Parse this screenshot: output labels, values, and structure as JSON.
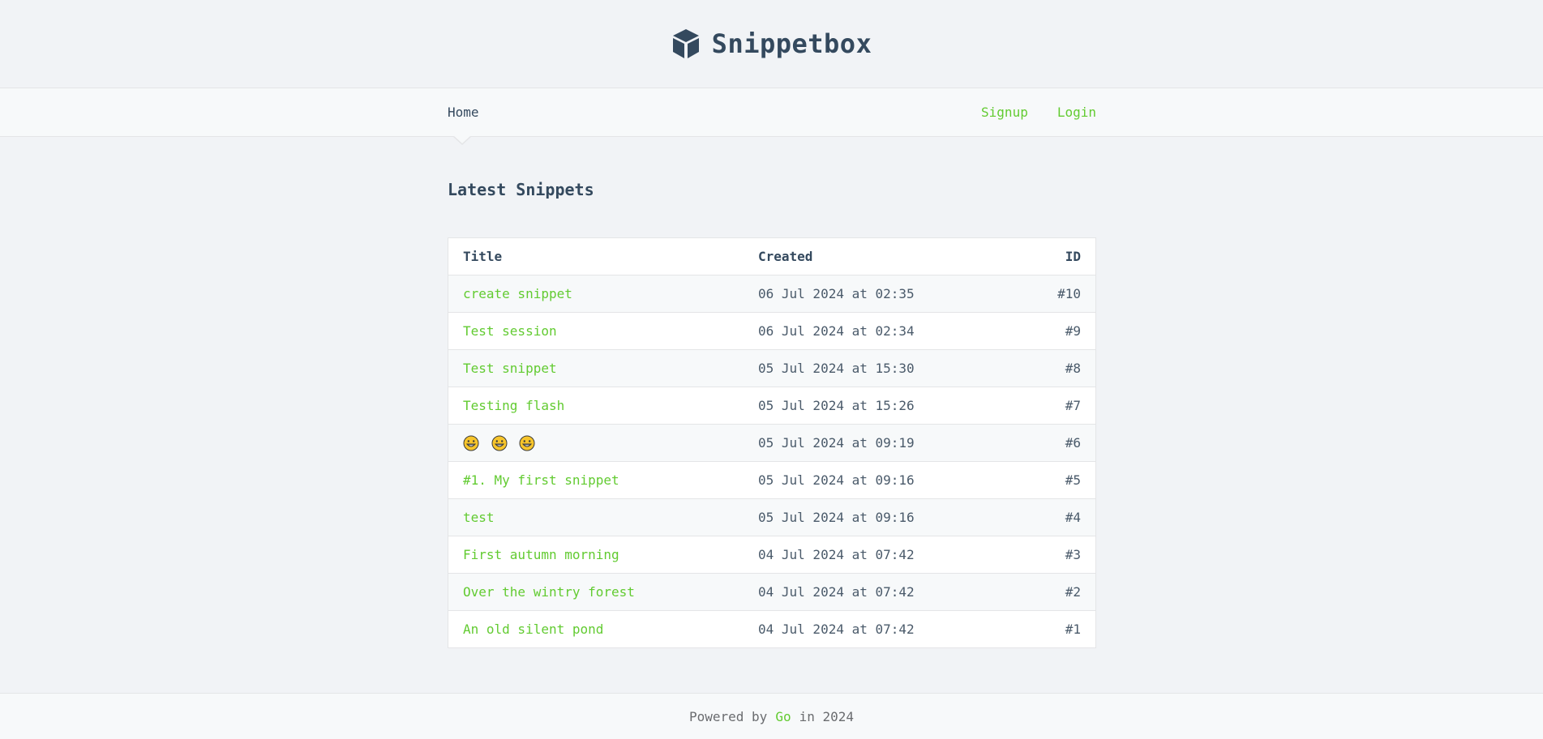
{
  "header": {
    "brand_name": "Snippetbox",
    "logo_icon": "cube-icon"
  },
  "nav": {
    "home_label": "Home",
    "signup_label": "Signup",
    "login_label": "Login"
  },
  "main": {
    "title": "Latest Snippets",
    "table": {
      "columns": [
        "Title",
        "Created",
        "ID"
      ],
      "rows": [
        {
          "title": "create snippet",
          "created": "06 Jul 2024 at 02:35",
          "id": "#10"
        },
        {
          "title": "Test session",
          "created": "06 Jul 2024 at 02:34",
          "id": "#9"
        },
        {
          "title": "Test snippet",
          "created": "05 Jul 2024 at 15:30",
          "id": "#8"
        },
        {
          "title": "Testing flash",
          "created": "05 Jul 2024 at 15:26",
          "id": "#7"
        },
        {
          "title": "😁😁😁",
          "created": "05 Jul 2024 at 09:19",
          "id": "#6"
        },
        {
          "title": "#1. My first snippet",
          "created": "05 Jul 2024 at 09:16",
          "id": "#5"
        },
        {
          "title": "test",
          "created": "05 Jul 2024 at 09:16",
          "id": "#4"
        },
        {
          "title": "First autumn morning",
          "created": "04 Jul 2024 at 07:42",
          "id": "#3"
        },
        {
          "title": "Over the wintry forest",
          "created": "04 Jul 2024 at 07:42",
          "id": "#2"
        },
        {
          "title": "An old silent pond",
          "created": "04 Jul 2024 at 07:42",
          "id": "#1"
        }
      ]
    }
  },
  "footer": {
    "prefix": "Powered by",
    "link_label": "Go",
    "suffix": "in 2024"
  },
  "colors": {
    "text": "#34495e",
    "accent": "#62cb31",
    "background": "#f1f3f6"
  }
}
